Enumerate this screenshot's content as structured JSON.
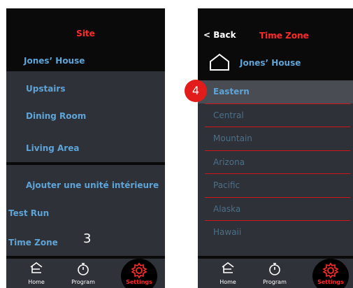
{
  "left": {
    "title": "Site",
    "site_name": "Jones’ House",
    "rooms": [
      "Upstairs",
      "Dining Room",
      "Living Area"
    ],
    "add_unit": "Ajouter une unité intérieure",
    "test_run": "Test Run",
    "time_zone": "Time Zone",
    "step_number": "3"
  },
  "right": {
    "back_label": "Back",
    "back_glyph": "<",
    "title": "Time Zone",
    "site_name": "Jones’ House",
    "step_number": "4",
    "time_zones": [
      "Eastern",
      "Central",
      "Mountain",
      "Arizona",
      "Pacific",
      "Alaska",
      "Hawaii"
    ],
    "selected": "Eastern"
  },
  "nav": {
    "home": "Home",
    "program": "Program",
    "settings": "Settings"
  },
  "colors": {
    "accent_red": "#ff2a2a",
    "link_blue": "#5ea4d6",
    "panel_bg": "#2e3138",
    "header_bg": "#0a0a0a"
  },
  "icons": {
    "home": "home-icon",
    "program": "stopwatch-icon",
    "settings": "gear-icon"
  }
}
